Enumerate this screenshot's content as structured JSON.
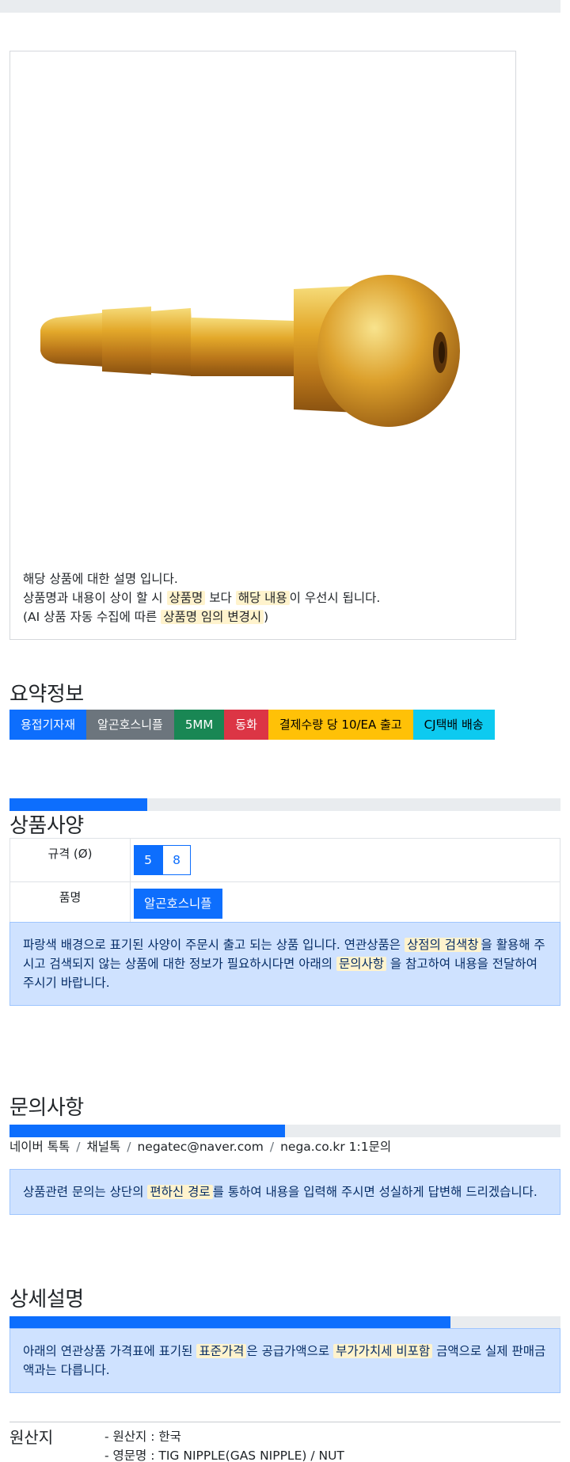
{
  "product": {
    "image_label": "brass gas nipple",
    "desc_line1": "해당 상품에 대한 설명 입니다.",
    "desc_line2_a": "상품명과 내용이 상이 할 시",
    "desc_line2_hl1": "상품명",
    "desc_line2_b": "보다",
    "desc_line2_hl2": "해당 내용",
    "desc_line2_c": "이 우선시 됩니다.",
    "desc_line3_a": "(AI 상품 자동 수집에 따른",
    "desc_line3_hl": "상품명 임의 변경시",
    "desc_line3_b": ")"
  },
  "summary": {
    "title": "요약정보",
    "badges": [
      "용접기자재",
      "알곤호스니플",
      "5MM",
      "동화",
      "결제수량 당 10/EA 출고",
      "CJ택배 배송"
    ]
  },
  "specs": {
    "title": "상품사양",
    "progress_percent": 25,
    "size_label": "규격 (Ø)",
    "size_options": [
      "5",
      "8"
    ],
    "size_selected": "5",
    "name_label": "품명",
    "name_value": "알곤호스니플",
    "notice_a": "파랑색 배경으로 표기된 사양이 주문시 출고 되는 상품 입니다. 연관상품은",
    "notice_hl1": "상점의 검색창",
    "notice_b": "을 활용해 주시고 검색되지 않는 상품에 대한 정보가 필요하시다면 아래의",
    "notice_hl2": "문의사항",
    "notice_c": "을 참고하여 내용을 전달하여 주시기 바랍니다."
  },
  "inquiry": {
    "title": "문의사항",
    "progress_percent": 50,
    "channels": [
      "네이버 톡톡",
      "채널톡",
      "negatec@naver.com",
      "nega.co.kr 1:1문의"
    ],
    "notice_a": "상품관련 문의는 상단의",
    "notice_hl": "편하신 경로",
    "notice_b": "를 통하여 내용을 입력해 주시면 성실하게 답변해 드리겠습니다."
  },
  "detail": {
    "title": "상세설명",
    "progress_percent": 80,
    "notice_a": "아래의 연관상품 가격표에 표기된",
    "notice_hl1": "표준가격",
    "notice_b": "은 공급가액으로",
    "notice_hl2": "부가가치세 비포함",
    "notice_c": "금액으로 실제 판매금액과는 다릅니다."
  },
  "origin": {
    "title": "원산지",
    "line1": "- 원산지 : 한국",
    "line2": "- 영문명 : TIG NIPPLE(GAS NIPPLE) / NUT"
  },
  "colors": {
    "primary": "#0d6efd",
    "secondary": "#6c757d",
    "success": "#198754",
    "danger": "#dc3545",
    "warning": "#ffc107",
    "info": "#0dcaf0",
    "alert_bg": "#cfe2ff",
    "highlight": "#fff3cd"
  }
}
